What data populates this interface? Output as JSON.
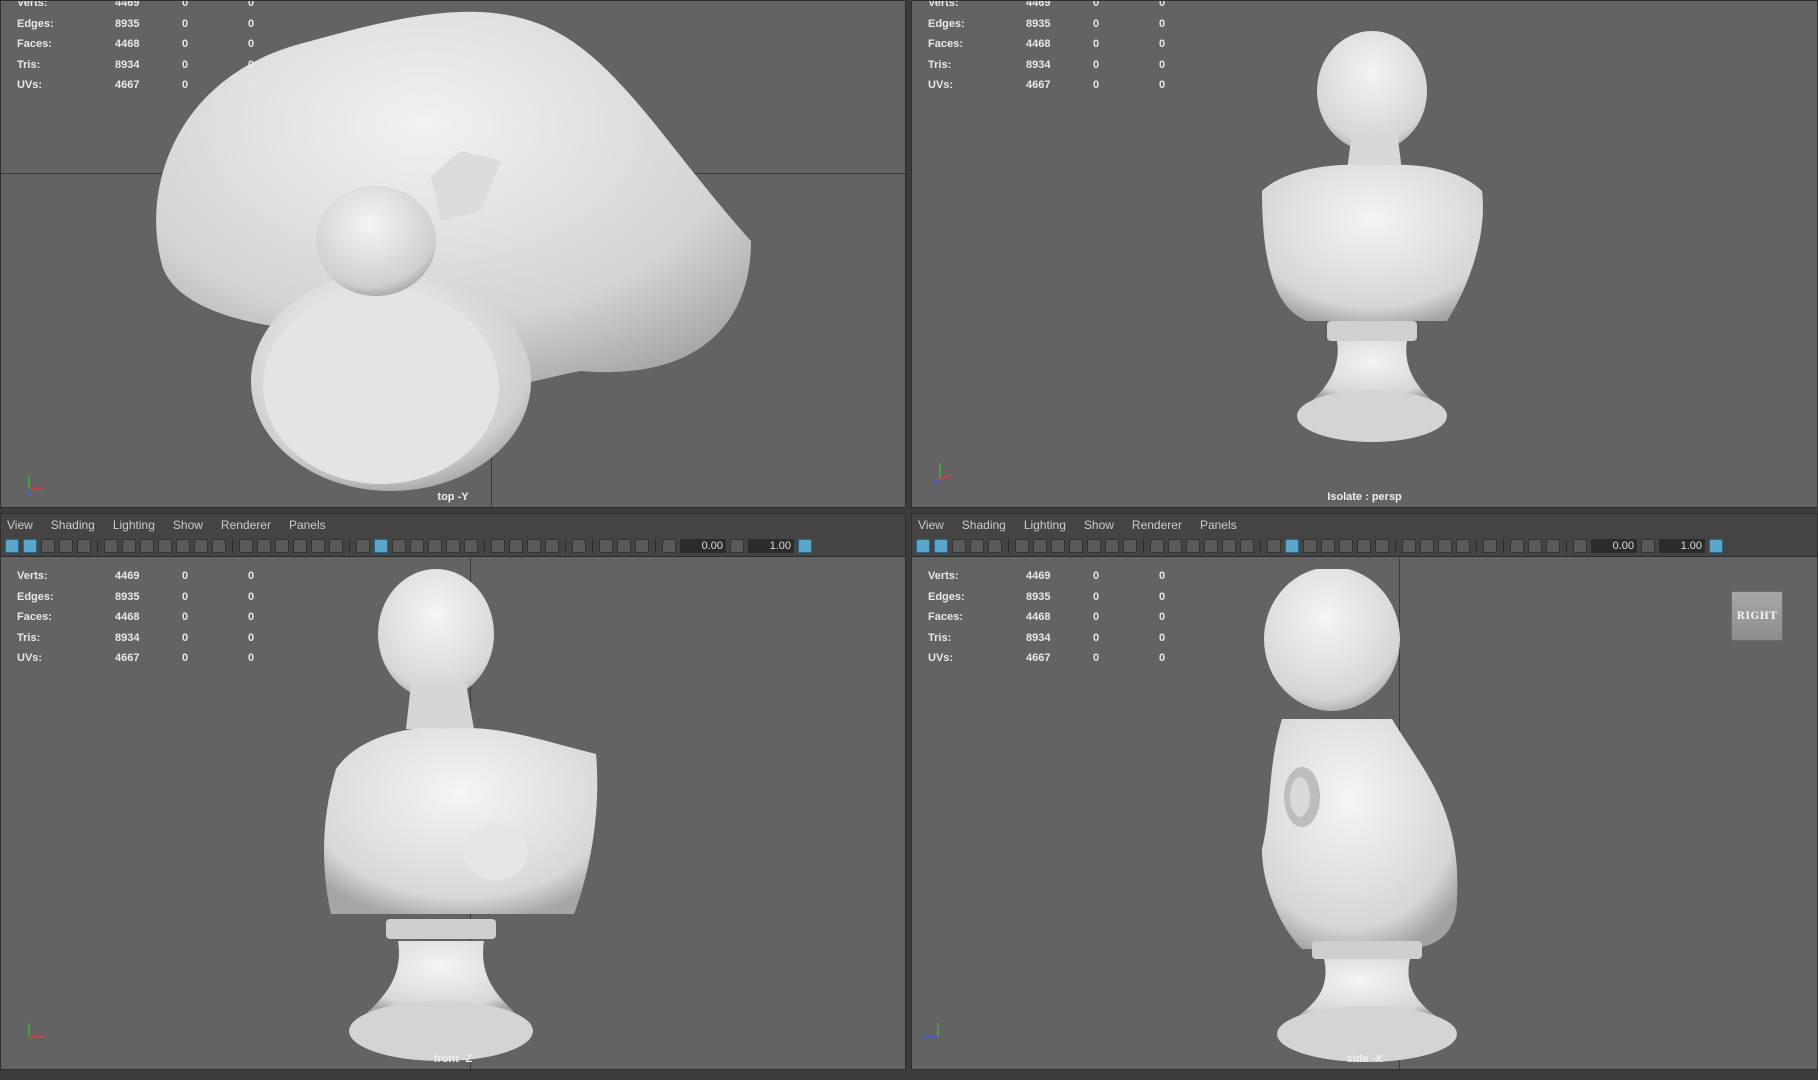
{
  "menu": [
    "View",
    "Shading",
    "Lighting",
    "Show",
    "Renderer",
    "Panels"
  ],
  "toolbar": {
    "field1": "0.00",
    "field2": "1.00"
  },
  "hud": {
    "rows": [
      {
        "label": "Verts:",
        "v1": "4469",
        "v2": "0",
        "v3": "0"
      },
      {
        "label": "Edges:",
        "v1": "8935",
        "v2": "0",
        "v3": "0"
      },
      {
        "label": "Faces:",
        "v1": "4468",
        "v2": "0",
        "v3": "0"
      },
      {
        "label": "Tris:",
        "v1": "8934",
        "v2": "0",
        "v3": "0"
      },
      {
        "label": "UVs:",
        "v1": "4667",
        "v2": "0",
        "v3": "0"
      }
    ]
  },
  "viewports": {
    "top": {
      "camera": "top -Y"
    },
    "persp": {
      "camera": "Isolate : persp"
    },
    "front": {
      "camera": "front -Z"
    },
    "side": {
      "camera": "side -X"
    }
  },
  "viewcube": {
    "label": "RIGHT"
  },
  "icons": [
    "axis-gizmo-icon",
    "bust-model"
  ],
  "colors": {
    "viewport_bg": "#636363",
    "accent": "#5aa6c8",
    "model": "#e2e2e2"
  }
}
